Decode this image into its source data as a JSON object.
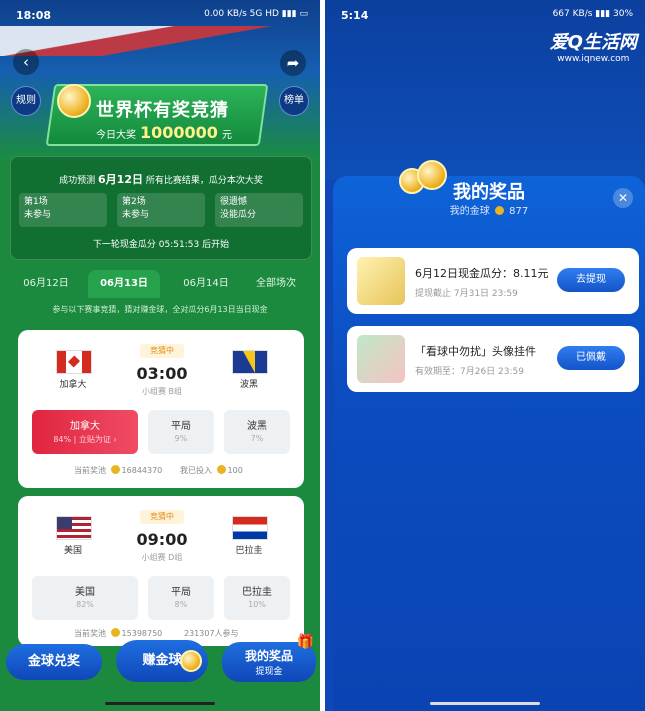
{
  "left": {
    "status_time": "18:08",
    "status_right": "0.00 KB/s  5G  HD  ▮▮▮  ▭",
    "header": {
      "back_icon": "back-icon",
      "share_icon": "share-icon",
      "rules_label": "规则",
      "ranking_label": "榜单",
      "title": "世界杯有奖竞猜",
      "jackpot_prefix": "今日大奖",
      "jackpot_amount": "1000000",
      "jackpot_unit": "元"
    },
    "info": {
      "line_prefix": "成功预测",
      "date": "6月12日",
      "line_suffix": "所有比赛结果，瓜分本次大奖",
      "steps": [
        {
          "title": "第1场",
          "status": "未参与"
        },
        {
          "title": "第2场",
          "status": "未参与"
        },
        {
          "title": "很遗憾",
          "status": "没能瓜分"
        }
      ],
      "countdown": "下一轮现金瓜分 05:51:53 后开始"
    },
    "tabs": [
      "06月12日",
      "06月13日",
      "06月14日",
      "全部场次"
    ],
    "active_tab": "06月13日",
    "hint": "参与以下赛事竞猜，猜对赚金球，全对瓜分6月13日当日现金",
    "matches": [
      {
        "home": "加拿大",
        "away": "波黑",
        "status": "竞猜中",
        "time": "03:00",
        "group": "小组赛 B组",
        "options": [
          {
            "label": "加拿大",
            "pct": "84%",
            "extra": "立贴为证 ›"
          },
          {
            "label": "平局",
            "pct": "9%"
          },
          {
            "label": "波黑",
            "pct": "7%"
          }
        ],
        "pool_label": "当前奖池",
        "pool": "16844370",
        "invested_label": "我已投入",
        "invested": "100"
      },
      {
        "home": "美国",
        "away": "巴拉圭",
        "status": "竞猜中",
        "time": "09:00",
        "group": "小组赛 D组",
        "options": [
          {
            "label": "美国",
            "pct": "82%"
          },
          {
            "label": "平局",
            "pct": "8%"
          },
          {
            "label": "巴拉圭",
            "pct": "10%"
          }
        ],
        "pool_label": "当前奖池",
        "pool": "15398750",
        "participants": "231307人参与"
      }
    ],
    "bottom": {
      "exchange": "金球兑奖",
      "earn": "赚金球",
      "my_prize": "我的奖品",
      "my_prize_sub": "提现金"
    }
  },
  "right": {
    "status_time": "5:14",
    "status_right": "667 KB/s  ▮▮▮  30%",
    "watermark": "爱Q生活网",
    "watermark_url": "www.iqnew.com",
    "modal": {
      "title": "我的奖品",
      "coins_label": "我的金球",
      "coins": "877",
      "close_icon": "close-icon",
      "prizes": [
        {
          "title": "6月12日现金瓜分：8.11元",
          "sub": "提现截止 7月31日 23:59",
          "button": "去提现"
        },
        {
          "title": "「看球中勿扰」头像挂件",
          "sub": "有效期至：7月26日 23:59",
          "button": "已佩戴"
        }
      ]
    }
  },
  "colors": {
    "green_bg": "#1c8a3e",
    "blue_bg": "#0f47b8",
    "selected_option": "#e0253f",
    "status_orange": "#e08f1a",
    "button_blue": "#1f66dc"
  }
}
